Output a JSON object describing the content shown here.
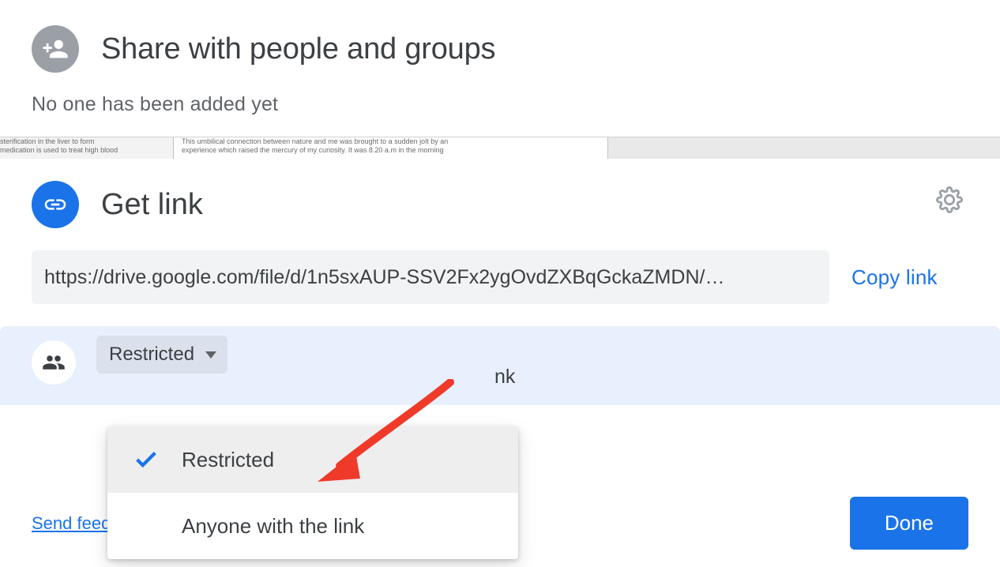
{
  "share": {
    "title": "Share with people and groups",
    "subtitle": "No one has been added yet"
  },
  "getlink": {
    "title": "Get link",
    "url": "https://drive.google.com/file/d/1n5sxAUP-SSV2Fx2ygOvdZXBqGckaZMDN/…",
    "copy_label": "Copy link",
    "partial_hint": "nk"
  },
  "access": {
    "selected_label": "Restricted",
    "options": [
      {
        "label": "Restricted",
        "selected": true
      },
      {
        "label": "Anyone with the link",
        "selected": false
      }
    ]
  },
  "footer": {
    "feedback_label": "Send feed",
    "done_label": "Done"
  },
  "doc_strip": {
    "col1_line1": "sterification in the liver to form",
    "col1_line2": "medication is used to treat high blood",
    "col2_line1": "This umbilical connection between nature and me was brought to a sudden jolt by an",
    "col2_line2": "experience which raised the mercury of my curiosity. It was 8.20 a.m in the morning"
  },
  "colors": {
    "accent": "#1a73e8",
    "muted_bg": "#f1f3f4",
    "selection_bg": "#e8f0fe",
    "arrow": "#ef3a2a"
  }
}
